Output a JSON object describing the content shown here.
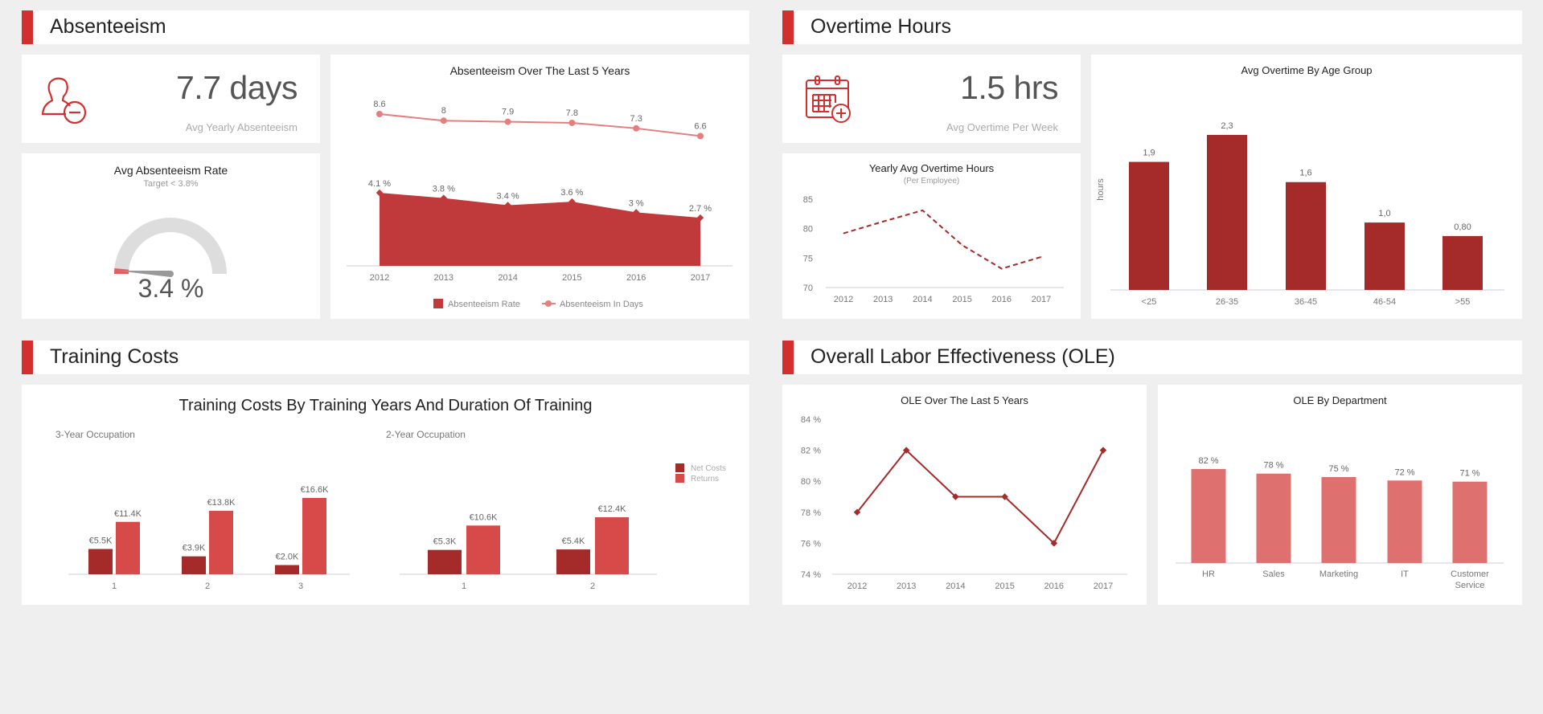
{
  "colors": {
    "accent": "#d32f2f",
    "dark_red": "#a52a2a",
    "area_red": "#c0393b",
    "line_pink": "#e57f7f",
    "bar_red": "#d64a4a",
    "bar_pink": "#df7070",
    "gauge_track": "#dddddd",
    "gauge_fill": "#e06060"
  },
  "sections": {
    "absenteeism": {
      "title": "Absenteeism",
      "kpi": {
        "icon": "user-minus-icon",
        "value": "7.7 days",
        "label": "Avg Yearly Absenteeism"
      },
      "gauge": {
        "title": "Avg Absenteeism Rate",
        "subtitle": "Target < 3.8%",
        "value_text": "3.4 %",
        "value": 3.4,
        "target": 3.8
      }
    },
    "overtime": {
      "title": "Overtime Hours",
      "kpi": {
        "icon": "calendar-plus-icon",
        "value": "1.5 hrs",
        "label": "Avg Overtime Per Week"
      }
    },
    "training": {
      "title": "Training Costs"
    },
    "ole": {
      "title": "Overall Labor Effectiveness (OLE)"
    }
  },
  "chart_data": [
    {
      "id": "absenteeism_5y",
      "type": "area",
      "title": "Absenteeism Over The Last 5 Years",
      "categories": [
        "2012",
        "2013",
        "2014",
        "2015",
        "2016",
        "2017"
      ],
      "series": [
        {
          "name": "Absenteeism Rate",
          "kind": "area",
          "values": [
            4.1,
            3.8,
            3.4,
            3.6,
            3.0,
            2.7
          ],
          "labels": [
            "4.1 %",
            "3.8 %",
            "3.4 %",
            "3.6 %",
            "3 %",
            "2.7 %"
          ]
        },
        {
          "name": "Absenteeism In Days",
          "kind": "line",
          "values": [
            8.6,
            8.0,
            7.9,
            7.8,
            7.3,
            6.6
          ],
          "labels": [
            "8.6",
            "8",
            "7.9",
            "7.8",
            "7.3",
            "6.6"
          ]
        }
      ],
      "legend": "bottom"
    },
    {
      "id": "overtime_yearly",
      "type": "line",
      "title": "Yearly Avg Overtime Hours",
      "subtitle": "(Per Employee)",
      "categories": [
        "2012",
        "2013",
        "2014",
        "2015",
        "2016",
        "2017"
      ],
      "values": [
        79.2,
        81.2,
        83.1,
        77.2,
        73.2,
        75.2
      ],
      "yticks": [
        "70",
        "75",
        "80",
        "85"
      ],
      "ylim": [
        70,
        85
      ],
      "line_style": "dashed"
    },
    {
      "id": "overtime_age",
      "type": "bar",
      "title": "Avg Overtime By Age Group",
      "ylabel": "hours",
      "categories": [
        "<25",
        "26-35",
        "36-45",
        "46-54",
        ">55"
      ],
      "values": [
        1.9,
        2.3,
        1.6,
        1.0,
        0.8
      ],
      "labels": [
        "1,9",
        "2,3",
        "1,6",
        "1,0",
        "0,80"
      ],
      "ylim": [
        0,
        2.4
      ]
    },
    {
      "id": "training_costs",
      "type": "bar",
      "title": "Training Costs By Training Years And Duration Of Training",
      "legend": [
        "Net Costs",
        "Returns"
      ],
      "legend_position": "top-right",
      "groups": [
        {
          "name": "3-Year Occupation",
          "categories": [
            "1",
            "2",
            "3"
          ],
          "series": [
            {
              "name": "Net Costs",
              "values": [
                5.5,
                3.9,
                2.0
              ],
              "labels": [
                "€5.5K",
                "€3.9K",
                "€2.0K"
              ]
            },
            {
              "name": "Returns",
              "values": [
                11.4,
                13.8,
                16.6
              ],
              "labels": [
                "€11.4K",
                "€13.8K",
                "€16.6K"
              ]
            }
          ]
        },
        {
          "name": "2-Year Occupation",
          "categories": [
            "1",
            "2"
          ],
          "series": [
            {
              "name": "Net Costs",
              "values": [
                5.3,
                5.4
              ],
              "labels": [
                "€5.3K",
                "€5.4K"
              ]
            },
            {
              "name": "Returns",
              "values": [
                10.6,
                12.4
              ],
              "labels": [
                "€10.6K",
                "€12.4K"
              ]
            }
          ]
        }
      ],
      "ylim": [
        0,
        17
      ]
    },
    {
      "id": "ole_5y",
      "type": "line",
      "title": "OLE Over The Last 5 Years",
      "categories": [
        "2012",
        "2013",
        "2014",
        "2015",
        "2016",
        "2017"
      ],
      "values": [
        78,
        82,
        79,
        79,
        76,
        82
      ],
      "yticks": [
        "74 %",
        "76 %",
        "78 %",
        "80 %",
        "82 %",
        "84 %"
      ],
      "ylim": [
        74,
        84
      ]
    },
    {
      "id": "ole_dept",
      "type": "bar",
      "title": "OLE By Department",
      "categories": [
        "HR",
        "Sales",
        "Marketing",
        "IT",
        "Customer Service"
      ],
      "values": [
        82,
        78,
        75,
        72,
        71
      ],
      "labels": [
        "82 %",
        "78 %",
        "75 %",
        "72 %",
        "71 %"
      ],
      "ylim": [
        0,
        100
      ]
    }
  ]
}
